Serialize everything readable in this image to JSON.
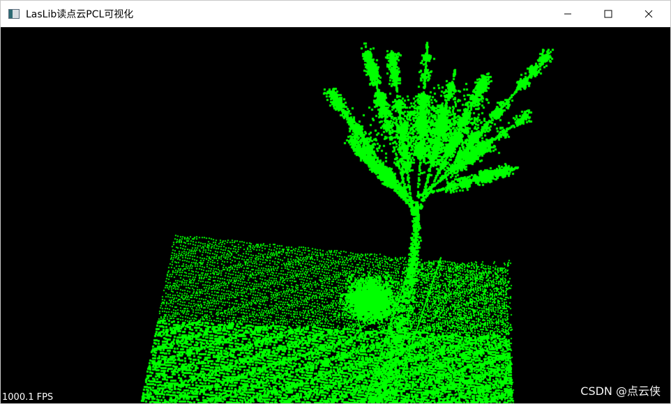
{
  "window": {
    "title": "LasLib读点云PCL可视化",
    "icon": "app-window-icon"
  },
  "caption_buttons": {
    "minimize": "minimize-icon",
    "maximize": "maximize-icon",
    "close": "close-icon"
  },
  "viewport": {
    "background_color": "#000000",
    "point_color": "#00ff00",
    "fps_label": "1000.1 FPS",
    "watermark": "CSDN @点云侠"
  }
}
